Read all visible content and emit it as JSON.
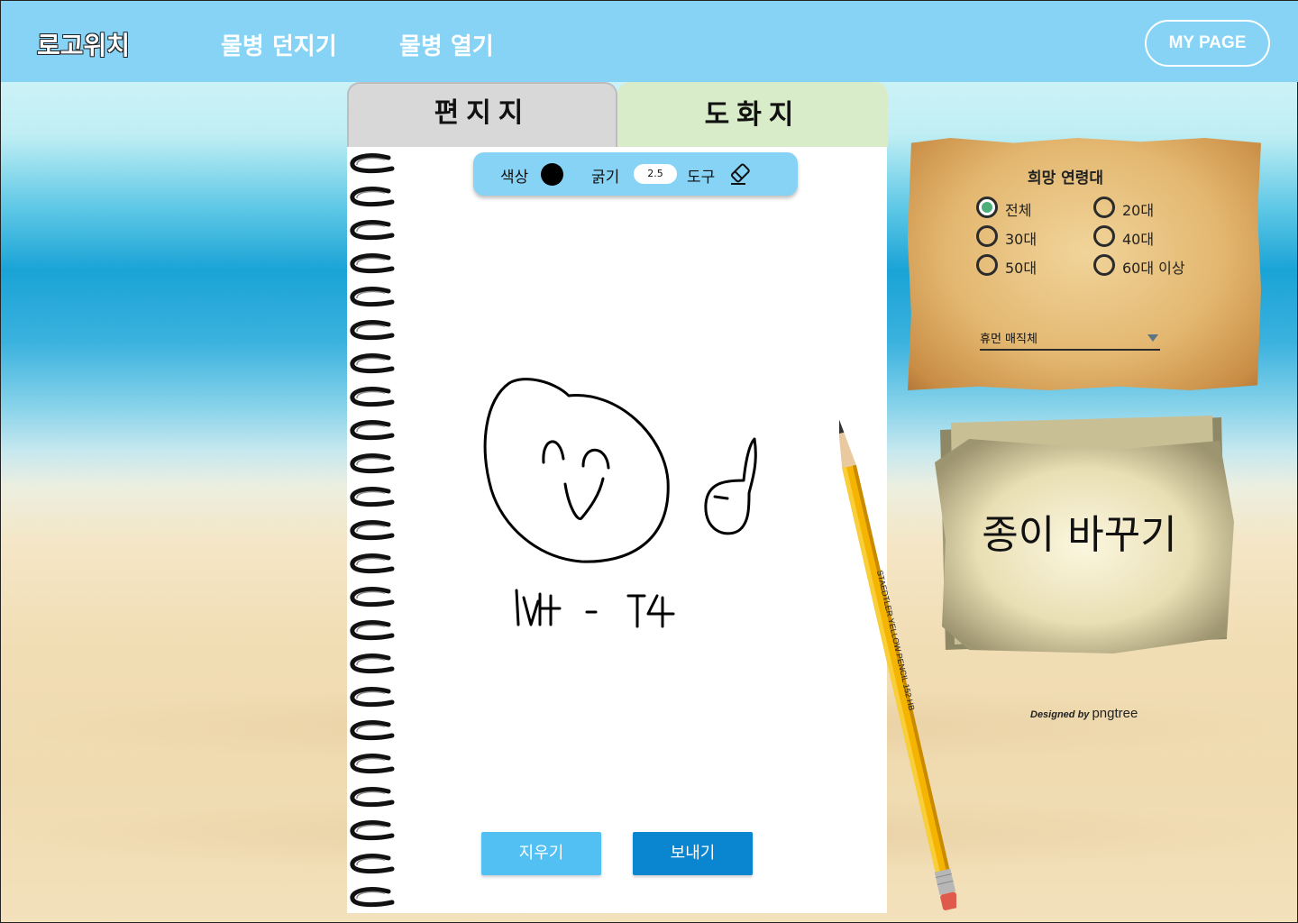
{
  "header": {
    "logo": "로고위치",
    "nav": [
      "물병 던지기",
      "물병 열기"
    ],
    "mypage": "MY PAGE"
  },
  "tabs": {
    "letter": "편지지",
    "drawing": "도화지",
    "active": "drawing"
  },
  "toolbar": {
    "color_label": "색상",
    "color_value": "#000000",
    "thickness_label": "굵기",
    "thickness_value": "2.5",
    "tool_label": "도구",
    "tool_icon": "eraser-icon"
  },
  "drawing": {
    "text": "IYt - T4"
  },
  "buttons": {
    "clear": "지우기",
    "send": "보내기"
  },
  "pencil": {
    "imprint": "STAEDTLER YELLOW PENCIL 152 HB"
  },
  "age_panel": {
    "title": "희망 연령대",
    "options": [
      {
        "label": "전체",
        "selected": true
      },
      {
        "label": "20대",
        "selected": false
      },
      {
        "label": "30대",
        "selected": false
      },
      {
        "label": "40대",
        "selected": false
      },
      {
        "label": "50대",
        "selected": false
      },
      {
        "label": "60대 이상",
        "selected": false
      }
    ],
    "font_select": "휴먼 매직체"
  },
  "change_paper": "종이 바꾸기",
  "credit": {
    "prefix": "Designed by",
    "brand": "pngtree"
  },
  "colors": {
    "header": "#87d3f5",
    "toolbar": "#86d3f6",
    "clear_button": "#53c0f4",
    "send_button": "#0a86d1",
    "active_tab": "#d9ecc9",
    "inactive_tab": "#d8d8d8"
  }
}
